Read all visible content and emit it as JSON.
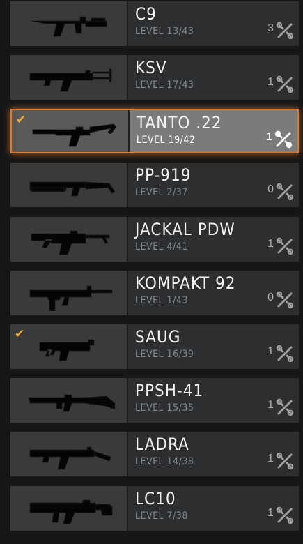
{
  "weapons": [
    {
      "name": "C9",
      "level": "LEVEL 13/43",
      "count": "3",
      "icon": "c9-smg-icon",
      "selected": false,
      "equipped": false
    },
    {
      "name": "KSV",
      "level": "LEVEL 17/43",
      "count": "1",
      "icon": "ksv-smg-icon",
      "selected": false,
      "equipped": false
    },
    {
      "name": "TANTO .22",
      "level": "LEVEL 19/42",
      "count": "1",
      "icon": "tanto-22-smg-icon",
      "selected": true,
      "equipped": true
    },
    {
      "name": "PP-919",
      "level": "LEVEL 2/37",
      "count": "0",
      "icon": "pp-919-smg-icon",
      "selected": false,
      "equipped": false
    },
    {
      "name": "JACKAL PDW",
      "level": "LEVEL 4/41",
      "count": "1",
      "icon": "jackal-pdw-smg-icon",
      "selected": false,
      "equipped": false
    },
    {
      "name": "KOMPAKT 92",
      "level": "LEVEL 1/43",
      "count": "0",
      "icon": "kompakt-92-smg-icon",
      "selected": false,
      "equipped": false
    },
    {
      "name": "SAUG",
      "level": "LEVEL 16/39",
      "count": "1",
      "icon": "saug-smg-icon",
      "selected": false,
      "equipped": true
    },
    {
      "name": "PPSH-41",
      "level": "LEVEL 15/35",
      "count": "1",
      "icon": "ppsh-41-smg-icon",
      "selected": false,
      "equipped": false
    },
    {
      "name": "LADRA",
      "level": "LEVEL 14/38",
      "count": "1",
      "icon": "ladra-smg-icon",
      "selected": false,
      "equipped": false
    },
    {
      "name": "LC10",
      "level": "LEVEL 7/38",
      "count": "1",
      "icon": "lc10-smg-icon",
      "selected": false,
      "equipped": false
    }
  ],
  "colors": {
    "accent": "#e07a2a",
    "check": "#f2b026"
  }
}
